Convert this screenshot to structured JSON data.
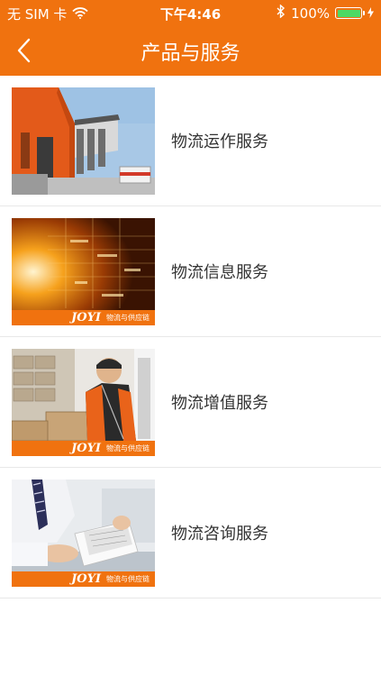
{
  "status_bar": {
    "carrier": "无 SIM 卡",
    "time": "下午4:46",
    "battery": "100%",
    "battery_level": 1.0
  },
  "nav": {
    "title": "产品与服务",
    "back_icon": "chevron-left-icon"
  },
  "brand": {
    "logo": "JOYI",
    "tagline": "物流与供应链"
  },
  "services": [
    {
      "label": "物流运作服务",
      "image": "warehouse-building"
    },
    {
      "label": "物流信息服务",
      "image": "data-center"
    },
    {
      "label": "物流增值服务",
      "image": "worker-boxes"
    },
    {
      "label": "物流咨询服务",
      "image": "consulting-documents"
    }
  ],
  "colors": {
    "accent": "#f0720f",
    "battery": "#4cd964"
  }
}
